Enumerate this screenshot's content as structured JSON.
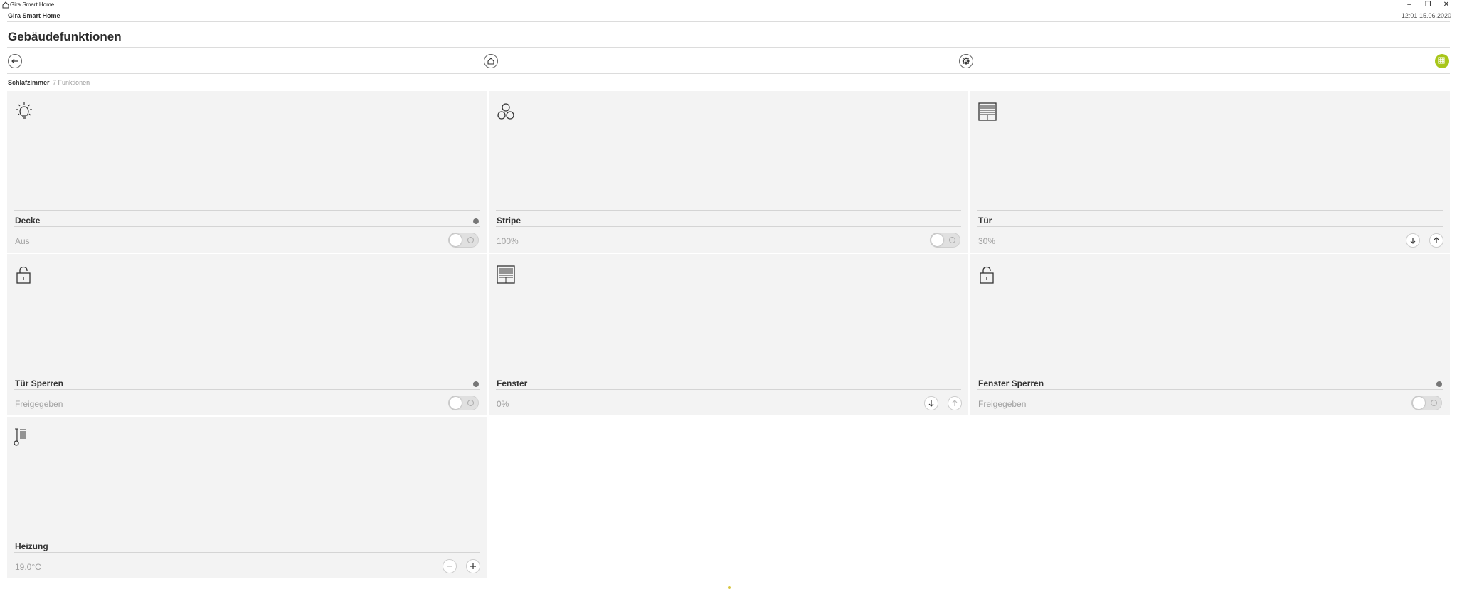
{
  "window": {
    "title": "Gira Smart Home",
    "controls": {
      "minimize": "–",
      "maximize": "❐",
      "close": "✕"
    }
  },
  "header": {
    "app_name": "Gira Smart Home",
    "time": "12:01",
    "date": "15.06.2020"
  },
  "page": {
    "title": "Gebäudefunktionen"
  },
  "nav": {
    "icons": [
      "back-arrow-icon",
      "home-icon",
      "settings-gear-icon",
      "grid-view-icon"
    ],
    "accent_color": "#a8c61a"
  },
  "breadcrumb": {
    "room": "Schlafzimmer",
    "count": "7 Funktionen"
  },
  "tiles": [
    {
      "name": "Decke",
      "value": "Aus",
      "icon": "light-bulb-icon",
      "control": "toggle",
      "status_dot": true
    },
    {
      "name": "Stripe",
      "value": "100%",
      "icon": "color-circles-icon",
      "control": "toggle",
      "status_dot": false
    },
    {
      "name": "Tür",
      "value": "30%",
      "icon": "blind-icon",
      "control": "down-up",
      "status_dot": false
    },
    {
      "name": "Tür Sperren",
      "value": "Freigegeben",
      "icon": "lock-open-icon",
      "control": "toggle",
      "status_dot": true
    },
    {
      "name": "Fenster",
      "value": "0%",
      "icon": "blind-icon",
      "control": "down-up",
      "status_dot": false
    },
    {
      "name": "Fenster Sperren",
      "value": "Freigegeben",
      "icon": "lock-open-icon",
      "control": "toggle",
      "status_dot": true
    },
    {
      "name": "Heizung",
      "value": "19.0°C",
      "icon": "thermometer-icon",
      "control": "minus-plus",
      "status_dot": false
    }
  ]
}
